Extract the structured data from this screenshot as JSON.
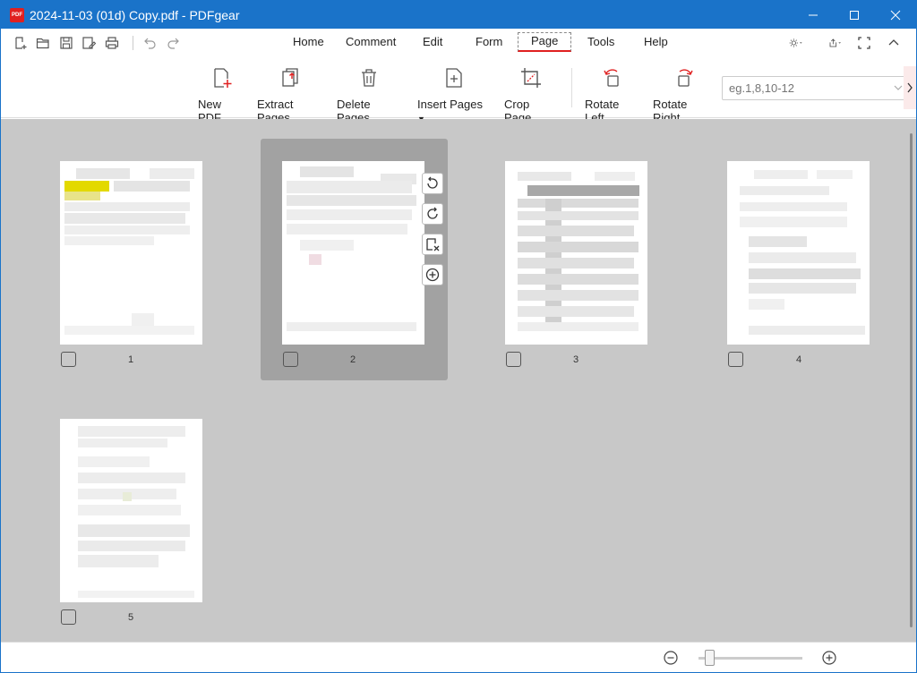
{
  "window": {
    "title": "2024-11-03 (01d) Copy.pdf - PDFgear",
    "logo_text": "PDF"
  },
  "menu": {
    "items": [
      {
        "label": "Home"
      },
      {
        "label": "Comment"
      },
      {
        "label": "Edit"
      },
      {
        "label": "Form"
      },
      {
        "label": "Page"
      },
      {
        "label": "Tools"
      },
      {
        "label": "Help"
      }
    ],
    "active": "Page"
  },
  "ribbon": {
    "new_pdf": "New PDF",
    "extract_pages": "Extract Pages",
    "delete_pages": "Delete Pages",
    "insert_pages": "Insert Pages",
    "crop_page": "Crop Page",
    "rotate_left": "Rotate Left",
    "rotate_right": "Rotate Right",
    "page_range_placeholder": "eg.1,8,10-12"
  },
  "pages": [
    {
      "number": "1",
      "selected": false
    },
    {
      "number": "2",
      "selected": true
    },
    {
      "number": "3",
      "selected": false
    },
    {
      "number": "4",
      "selected": false
    },
    {
      "number": "5",
      "selected": false
    }
  ],
  "colors": {
    "accent": "#1a73c9",
    "brand_red": "#e02020",
    "canvas": "#c8c8c8",
    "selection": "#a2a2a2"
  },
  "icons": [
    "new-file-icon",
    "open-folder-icon",
    "save-icon",
    "save-as-icon",
    "print-icon",
    "undo-icon",
    "redo-icon",
    "theme-icon",
    "share-icon",
    "fullscreen-icon",
    "collapse-ribbon-icon",
    "rotate-left-icon",
    "rotate-right-icon",
    "delete-page-icon",
    "insert-page-icon",
    "zoom-out-icon",
    "zoom-in-icon"
  ]
}
